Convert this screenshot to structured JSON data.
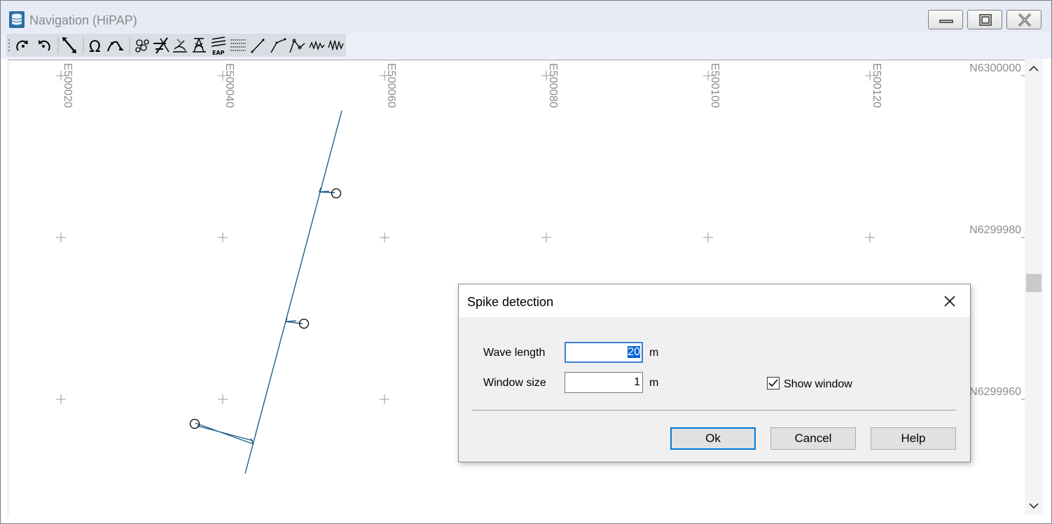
{
  "window": {
    "title": "Navigation (HiPAP)"
  },
  "toolbar": {
    "tools": [
      "rotate-clockwise-icon",
      "rotate-counterclockwise-icon",
      "diagonal-line-icon",
      "omega-icon",
      "curve-spike-icon",
      "filter-circles-icon",
      "cross-out-icon",
      "sonar-icon",
      "multibeam-icon",
      "eap-icon",
      "hatched-icon",
      "line-icon",
      "polyline-icon",
      "polyline-nodes-icon",
      "wave-small-icon",
      "wave-large-icon"
    ],
    "eap_label": "EAP"
  },
  "map": {
    "easting_labels": [
      "E500020",
      "E500040",
      "E500060",
      "E500080",
      "E500100",
      "E500120"
    ],
    "northing_labels": [
      "N6300000",
      "N6299980",
      "N6299960"
    ],
    "track_color": "#1f5f8b"
  },
  "dialog": {
    "title": "Spike detection",
    "wave_length_label": "Wave length",
    "wave_length_value": "20",
    "wave_length_unit": "m",
    "window_size_label": "Window size",
    "window_size_value": "1",
    "window_size_unit": "m",
    "show_window_label": "Show window",
    "show_window_checked": true,
    "ok_label": "Ok",
    "cancel_label": "Cancel",
    "help_label": "Help"
  }
}
